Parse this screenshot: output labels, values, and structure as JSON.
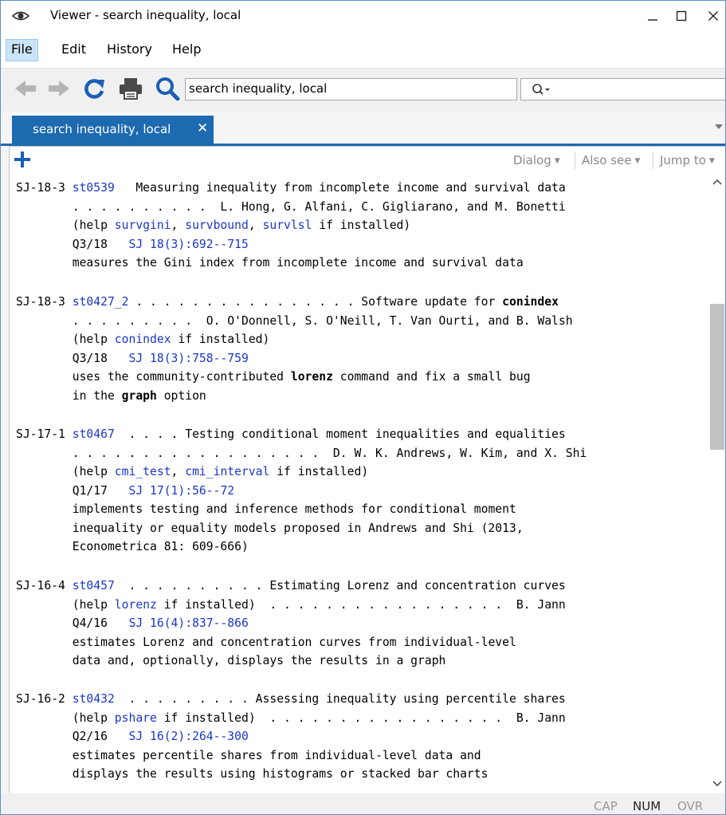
{
  "window": {
    "title": "Viewer - search inequality, local",
    "icon": "eye-icon"
  },
  "menubar": {
    "items": [
      "File",
      "Edit",
      "History",
      "Help"
    ]
  },
  "toolbar": {
    "address_value": "search inequality, local",
    "find_value": ""
  },
  "tabs": [
    {
      "label": "search inequality, local",
      "active": true
    }
  ],
  "viewer_bar": {
    "dialog": "Dialog",
    "also_see": "Also see",
    "jump_to": "Jump to"
  },
  "results": [
    {
      "lines": [
        [
          {
            "t": "SJ-18-3 "
          },
          {
            "t": "st0539",
            "link": true
          },
          {
            "t": "   Measuring inequality from incomplete income and survival data"
          }
        ],
        [
          {
            "t": "        . . . . . . . . . .  L. Hong, G. Alfani, C. Gigliarano, and M. Bonetti"
          }
        ],
        [
          {
            "t": "        (help "
          },
          {
            "t": "survgini",
            "link": true
          },
          {
            "t": ", "
          },
          {
            "t": "survbound",
            "link": true
          },
          {
            "t": ", "
          },
          {
            "t": "survlsl",
            "link": true
          },
          {
            "t": " if installed)"
          }
        ],
        [
          {
            "t": "        Q3/18   "
          },
          {
            "t": "SJ 18(3):692--715",
            "link": true
          }
        ],
        [
          {
            "t": "        measures the Gini index from incomplete income and survival data"
          }
        ]
      ]
    },
    {
      "lines": [
        [
          {
            "t": "SJ-18-3 "
          },
          {
            "t": "st0427_2",
            "link": true
          },
          {
            "t": " . . . . . . . . . . . . . . . . Software update for "
          },
          {
            "t": "conindex",
            "bold": true
          }
        ],
        [
          {
            "t": "        . . . . . . . . .  O. O'Donnell, S. O'Neill, T. Van Ourti, and B. Walsh"
          }
        ],
        [
          {
            "t": "        (help "
          },
          {
            "t": "conindex",
            "link": true
          },
          {
            "t": " if installed)"
          }
        ],
        [
          {
            "t": "        Q3/18   "
          },
          {
            "t": "SJ 18(3):758--759",
            "link": true
          }
        ],
        [
          {
            "t": "        uses the community-contributed "
          },
          {
            "t": "lorenz",
            "bold": true
          },
          {
            "t": " command and fix a small bug"
          }
        ],
        [
          {
            "t": "        in the "
          },
          {
            "t": "graph",
            "bold": true
          },
          {
            "t": " option"
          }
        ]
      ]
    },
    {
      "lines": [
        [
          {
            "t": "SJ-17-1 "
          },
          {
            "t": "st0467",
            "link": true
          },
          {
            "t": "  . . . . Testing conditional moment inequalities and equalities"
          }
        ],
        [
          {
            "t": "        . . . . . . . . . . . . . . . . . .  D. W. K. Andrews, W. Kim, and X. Shi"
          }
        ],
        [
          {
            "t": "        (help "
          },
          {
            "t": "cmi_test",
            "link": true
          },
          {
            "t": ", "
          },
          {
            "t": "cmi_interval",
            "link": true
          },
          {
            "t": " if installed)"
          }
        ],
        [
          {
            "t": "        Q1/17   "
          },
          {
            "t": "SJ 17(1):56--72",
            "link": true
          }
        ],
        [
          {
            "t": "        implements testing and inference methods for conditional moment"
          }
        ],
        [
          {
            "t": "        inequality or equality models proposed in Andrews and Shi (2013,"
          }
        ],
        [
          {
            "t": "        Econometrica 81: 609-666)"
          }
        ]
      ]
    },
    {
      "lines": [
        [
          {
            "t": "SJ-16-4 "
          },
          {
            "t": "st0457",
            "link": true
          },
          {
            "t": "  . . . . . . . . . . Estimating Lorenz and concentration curves"
          }
        ],
        [
          {
            "t": "        (help "
          },
          {
            "t": "lorenz",
            "link": true
          },
          {
            "t": " if installed)  . . . . . . . . . . . . . . . . .  B. Jann"
          }
        ],
        [
          {
            "t": "        Q4/16   "
          },
          {
            "t": "SJ 16(4):837--866",
            "link": true
          }
        ],
        [
          {
            "t": "        estimates Lorenz and concentration curves from individual-level"
          }
        ],
        [
          {
            "t": "        data and, optionally, displays the results in a graph"
          }
        ]
      ]
    },
    {
      "lines": [
        [
          {
            "t": "SJ-16-2 "
          },
          {
            "t": "st0432",
            "link": true
          },
          {
            "t": "  . . . . . . . . . Assessing inequality using percentile shares"
          }
        ],
        [
          {
            "t": "        (help "
          },
          {
            "t": "pshare",
            "link": true
          },
          {
            "t": " if installed)  . . . . . . . . . . . . . . . . .  B. Jann"
          }
        ],
        [
          {
            "t": "        Q2/16   "
          },
          {
            "t": "SJ 16(2):264--300",
            "link": true
          }
        ],
        [
          {
            "t": "        estimates percentile shares from individual-level data and"
          }
        ],
        [
          {
            "t": "        displays the results using histograms or stacked bar charts"
          }
        ]
      ]
    }
  ],
  "statusbar": {
    "cap": "CAP",
    "num": "NUM",
    "ovr": "OVR"
  },
  "colors": {
    "accent": "#1e6ab1",
    "link": "#1a37c8",
    "icon_blue": "#1a5fb4"
  }
}
